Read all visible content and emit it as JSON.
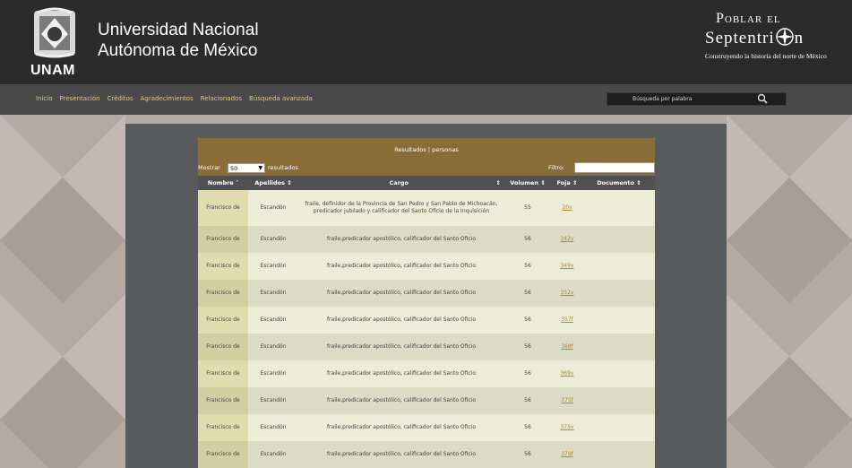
{
  "header": {
    "unam_logo_text": "UNAM",
    "university_name_line1": "Universidad Nacional",
    "university_name_line2": "Autónoma de México",
    "brand_line1": "Poblar el",
    "brand_line2_a": "Septentri",
    "brand_line2_b": "n",
    "brand_tagline": "Construyendo la historia del norte de México"
  },
  "nav": {
    "items": [
      "Inicio",
      "Presentación",
      "Créditos",
      "Agradecimientos",
      "Relacionados",
      "Búsqueda avanzada"
    ],
    "search_placeholder": "Búsqueda por palabra"
  },
  "results": {
    "title": "Resultados | personas",
    "show_label": "Mostrar",
    "page_size": "50",
    "results_label": "resultados",
    "filter_label": "Filtro:",
    "columns": [
      "Nombre",
      "Apellidos",
      "Cargo",
      "Volumen",
      "Foja",
      "Documento"
    ],
    "rows": [
      {
        "nombre": "Francisco de",
        "apellidos": "Escandón",
        "cargo": "fraile, definidor de la Provincia de San Pedro y San Pablo de Michoacán, predicador jubilado y calificador del Santo Oficio de la Inquisición",
        "volumen": "55",
        "foja": "20v",
        "documento": ""
      },
      {
        "nombre": "Francisco de",
        "apellidos": "Escandón",
        "cargo": "fraile,predicador apostólico, calificador del Santo Oficio",
        "volumen": "56",
        "foja": "342v",
        "documento": ""
      },
      {
        "nombre": "Francisco de",
        "apellidos": "Escandón",
        "cargo": "fraile,predicador apostólico, calificador del Santo Oficio",
        "volumen": "56",
        "foja": "349v",
        "documento": ""
      },
      {
        "nombre": "Francisco de",
        "apellidos": "Escandón",
        "cargo": "fraile,predicador apostólico, calificador del Santo Oficio",
        "volumen": "56",
        "foja": "352v",
        "documento": ""
      },
      {
        "nombre": "Francisco de",
        "apellidos": "Escandón",
        "cargo": "fraile,predicador apostólico, calificador del Santo Oficio",
        "volumen": "56",
        "foja": "357f",
        "documento": ""
      },
      {
        "nombre": "Francisco de",
        "apellidos": "Escandón",
        "cargo": "fraile,predicador apostólico, calificador del Santo Oficio",
        "volumen": "56",
        "foja": "368f",
        "documento": ""
      },
      {
        "nombre": "Francisco de",
        "apellidos": "Escandón",
        "cargo": "fraile,predicador apostólico, calificador del Santo Oficio",
        "volumen": "56",
        "foja": "369v",
        "documento": ""
      },
      {
        "nombre": "Francisco de",
        "apellidos": "Escandón",
        "cargo": "fraile,predicador apostólico, calificador del Santo Oficio",
        "volumen": "56",
        "foja": "375f",
        "documento": ""
      },
      {
        "nombre": "Francisco de",
        "apellidos": "Escandón",
        "cargo": "fraile,predicador apostólico, calificador del Santo Oficio",
        "volumen": "56",
        "foja": "375v",
        "documento": ""
      },
      {
        "nombre": "Francisco de",
        "apellidos": "Escandón",
        "cargo": "fraile,predicador apostólico, calificador del Santo Oficio",
        "volumen": "56",
        "foja": "379f",
        "documento": ""
      }
    ]
  },
  "colors": {
    "header_bg": "#2b2b2b",
    "nav_bg": "#4a4a4a",
    "nav_link": "#e3c47f",
    "results_header": "#8a6c38",
    "table_head": "#4f5051",
    "link": "#a7893d"
  },
  "icons": {
    "search": "magnifier-icon",
    "crest": "unam-crest-icon",
    "compass": "compass-rose-icon"
  }
}
